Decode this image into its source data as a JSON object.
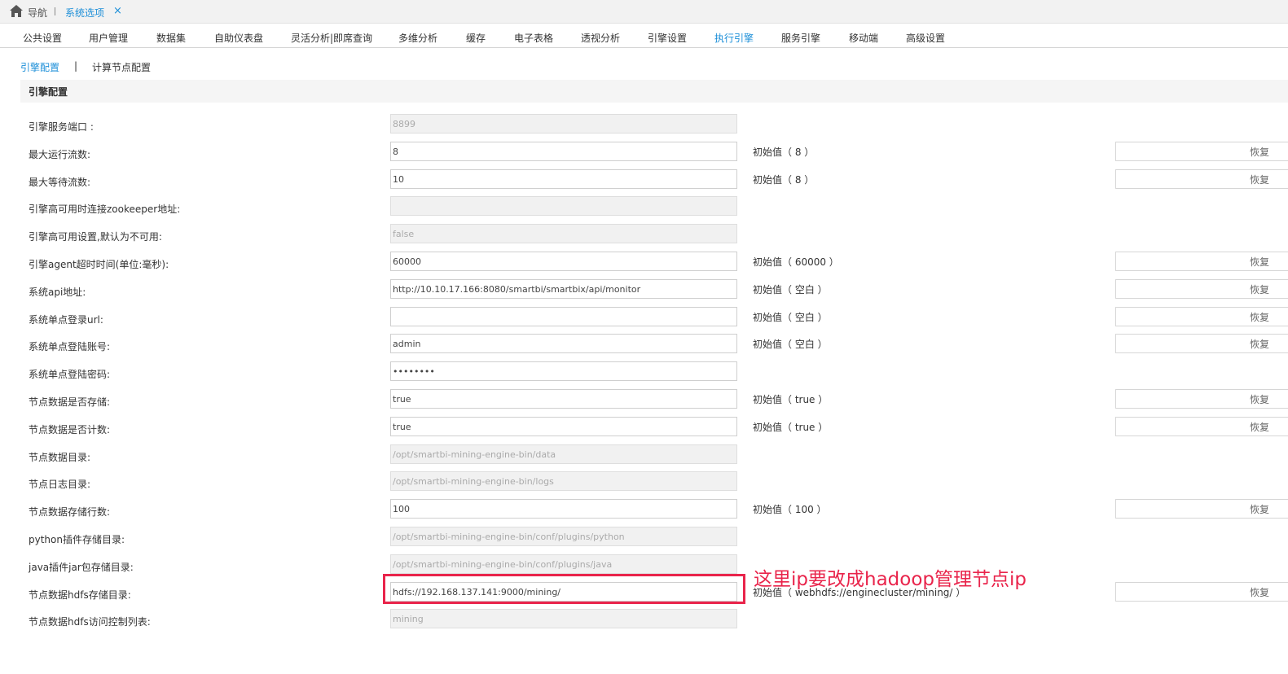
{
  "nav": {
    "label": "导航",
    "tab": "系统选项",
    "close": "×"
  },
  "menu": {
    "items": [
      "公共设置",
      "用户管理",
      "数据集",
      "自助仪表盘",
      "灵活分析|即席查询",
      "多维分析",
      "缓存",
      "电子表格",
      "透视分析",
      "引擎设置",
      "执行引擎",
      "服务引擎",
      "移动端",
      "高级设置"
    ],
    "active_index": 10
  },
  "subtabs": {
    "engine_config": "引擎配置",
    "separator": "|",
    "compute_node_config": "计算节点配置"
  },
  "section": {
    "title": "引擎配置"
  },
  "restore_label": "恢复",
  "rows": [
    {
      "label": "引擎服务端口 :",
      "value": "8899",
      "readonly": true,
      "initial": "",
      "restore": false
    },
    {
      "label": "最大运行流数:",
      "value": "8",
      "readonly": false,
      "initial": "初始值（ 8 ）",
      "restore": true
    },
    {
      "label": "最大等待流数:",
      "value": "10",
      "readonly": false,
      "initial": "初始值（ 8 ）",
      "restore": true
    },
    {
      "label": "引擎高可用时连接zookeeper地址:",
      "value": "",
      "readonly": true,
      "initial": "",
      "restore": false
    },
    {
      "label": "引擎高可用设置,默认为不可用:",
      "value": "false",
      "readonly": true,
      "initial": "",
      "restore": false
    },
    {
      "label": "引擎agent超时时间(单位:毫秒):",
      "value": "60000",
      "readonly": false,
      "initial": "初始值（ 60000 ）",
      "restore": true
    },
    {
      "label": "系统api地址:",
      "value": "http://10.10.17.166:8080/smartbi/smartbix/api/monitor",
      "readonly": false,
      "initial": "初始值（ 空白 ）",
      "restore": true
    },
    {
      "label": "系统单点登录url:",
      "value": "",
      "readonly": false,
      "initial": "初始值（ 空白 ）",
      "restore": true
    },
    {
      "label": "系统单点登陆账号:",
      "value": "admin",
      "readonly": false,
      "initial": "初始值（ 空白 ）",
      "restore": true
    },
    {
      "label": "系统单点登陆密码:",
      "value": "••••••••",
      "readonly": false,
      "initial": "",
      "restore": false
    },
    {
      "label": "节点数据是否存储:",
      "value": "true",
      "readonly": false,
      "initial": "初始值（ true ）",
      "restore": true
    },
    {
      "label": "节点数据是否计数:",
      "value": "true",
      "readonly": false,
      "initial": "初始值（ true ）",
      "restore": true
    },
    {
      "label": "节点数据目录:",
      "value": "/opt/smartbi-mining-engine-bin/data",
      "readonly": true,
      "initial": "",
      "restore": false
    },
    {
      "label": "节点日志目录:",
      "value": "/opt/smartbi-mining-engine-bin/logs",
      "readonly": true,
      "initial": "",
      "restore": false
    },
    {
      "label": "节点数据存储行数:",
      "value": "100",
      "readonly": false,
      "initial": "初始值（ 100 ）",
      "restore": true
    },
    {
      "label": "python插件存储目录:",
      "value": "/opt/smartbi-mining-engine-bin/conf/plugins/python",
      "readonly": true,
      "initial": "",
      "restore": false
    },
    {
      "label": "java插件jar包存储目录:",
      "value": "/opt/smartbi-mining-engine-bin/conf/plugins/java",
      "readonly": true,
      "initial": "",
      "restore": false
    },
    {
      "label": "节点数据hdfs存储目录:",
      "value": "hdfs://192.168.137.141:9000/mining/",
      "readonly": false,
      "initial": "初始值（ webhdfs://enginecluster/mining/ ）",
      "restore": true
    },
    {
      "label": "节点数据hdfs访问控制列表:",
      "value": "mining",
      "readonly": true,
      "initial": "",
      "restore": false
    }
  ],
  "annotation": {
    "text": "这里ip要改成hadoop管理节点ip",
    "color": "#e9244b"
  },
  "colors": {
    "accent": "#1d8fd8",
    "highlight": "#e9244b"
  }
}
